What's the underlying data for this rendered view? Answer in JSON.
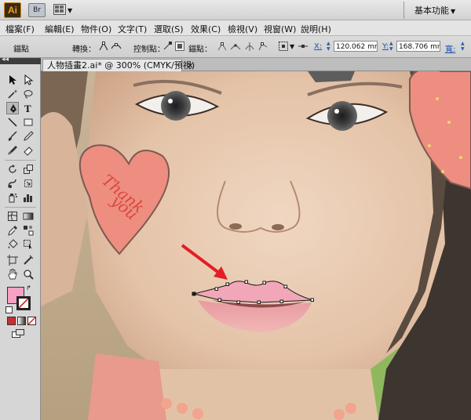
{
  "app": {
    "logo_text": "Ai",
    "bridge_label": "Br",
    "workspace": "基本功能"
  },
  "menu": [
    "檔案(F)",
    "編輯(E)",
    "物件(O)",
    "文字(T)",
    "選取(S)",
    "效果(C)",
    "檢視(V)",
    "視窗(W)",
    "說明(H)"
  ],
  "control": {
    "anchor_label": "錨點",
    "convert_label": "轉換：",
    "handles_label": "控制點：",
    "anchors_label": "錨點：",
    "x_label": "X:",
    "x_value": "120.062 mr",
    "y_label": "Y:",
    "y_value": "168.706 mr",
    "w_label": "寬:"
  },
  "document": {
    "tab_title": "人物插畫2.ai* @ 300% (CMYK/預視)",
    "close_glyph": "×"
  },
  "panel": {
    "collapse_glyph": "◂◂"
  },
  "canvas": {
    "heart_text_line1": "Thank",
    "heart_text_line2": "you"
  },
  "colors": {
    "fill_swatch": "#f7a1c4",
    "stroke_swatch": "#ffffff",
    "selection_path": "#1a1a1a",
    "arrow": "#e31e24",
    "lip_fill": "#f1a7b8",
    "heart_fill": "#ed8e80"
  }
}
